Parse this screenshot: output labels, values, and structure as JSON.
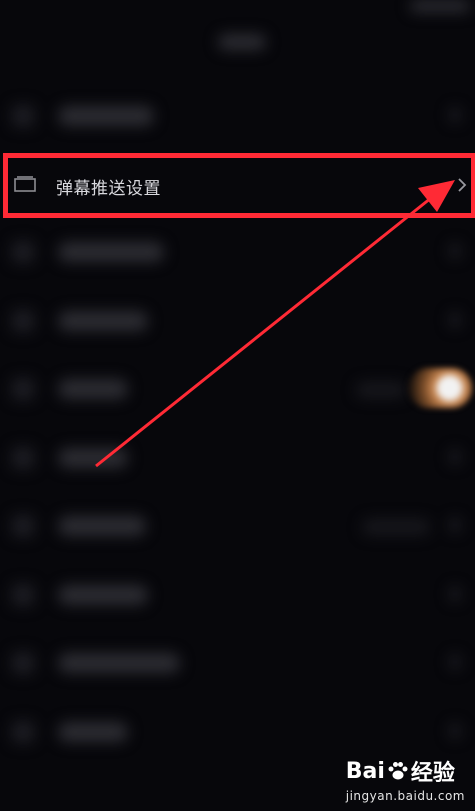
{
  "settings": {
    "highlighted_item": {
      "label": "弹幕推送设置",
      "icon": "window-icon",
      "chevron": "›"
    }
  },
  "annotation": {
    "color": "#ff2a35"
  },
  "watermark": {
    "brand_left": "Bai",
    "brand_right": "经验",
    "url": "jingyan.baidu.com"
  },
  "toggle_state": {
    "on": true
  }
}
